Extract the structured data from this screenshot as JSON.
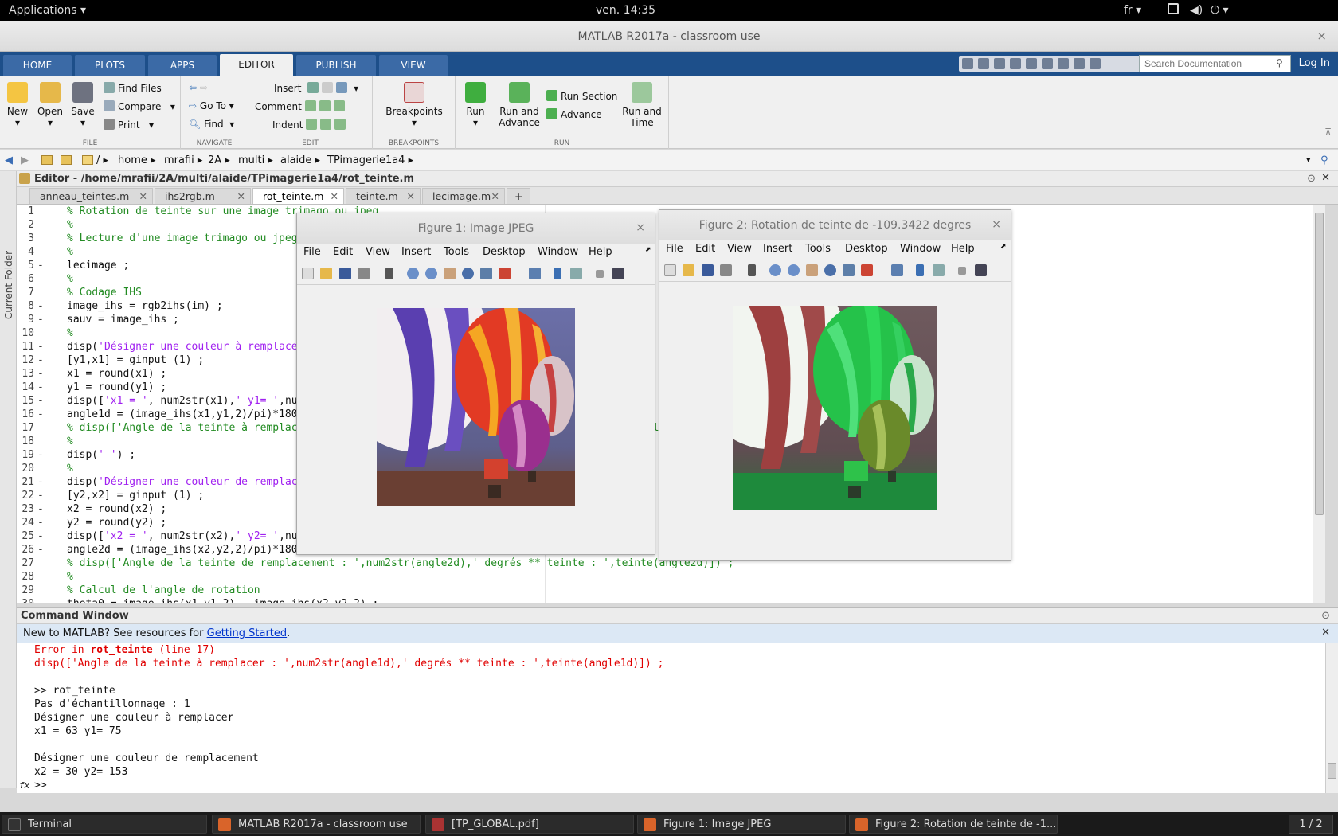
{
  "topbar": {
    "applications": "Applications",
    "clock": "ven. 14:35",
    "lang": "fr"
  },
  "window": {
    "title": "MATLAB R2017a - classroom use",
    "close": "×"
  },
  "tabs": [
    "HOME",
    "PLOTS",
    "APPS",
    "EDITOR",
    "PUBLISH",
    "VIEW"
  ],
  "active_tab": "EDITOR",
  "search": {
    "placeholder": "Search Documentation"
  },
  "login": "Log In",
  "ribbon": {
    "file": {
      "label": "FILE",
      "new": "New",
      "open": "Open",
      "save": "Save",
      "find_files": "Find Files",
      "compare": "Compare",
      "print": "Print"
    },
    "navigate": {
      "label": "NAVIGATE",
      "go_to": "Go To",
      "find": "Find"
    },
    "edit": {
      "label": "EDIT",
      "insert": "Insert",
      "comment": "Comment",
      "indent": "Indent"
    },
    "breakpoints": {
      "label": "BREAKPOINTS",
      "breakpoints": "Breakpoints"
    },
    "run": {
      "label": "RUN",
      "run": "Run",
      "run_and_advance": "Run and Advance",
      "run_section": "Run Section",
      "advance": "Advance",
      "run_and_time": "Run and Time"
    }
  },
  "path": [
    "/",
    "home",
    "mrafii",
    "2A",
    "multi",
    "alaide",
    "TPimagerie1a4"
  ],
  "side": {
    "current_folder": "Current Folder"
  },
  "editor": {
    "title": "Editor - /home/mrafii/2A/multi/alaide/TPimagerie1a4/rot_teinte.m",
    "tabs": [
      "anneau_teintes.m",
      "ihs2rgb.m",
      "rot_teinte.m",
      "teinte.m",
      "lecimage.m"
    ],
    "active_tab": "rot_teinte.m",
    "add_tab": "+",
    "lines": [
      {
        "n": "1",
        "dash": "",
        "segs": [
          {
            "t": "% Rotation de teinte sur une image trimago ou jpeg",
            "c": "cm"
          }
        ]
      },
      {
        "n": "2",
        "dash": "",
        "segs": [
          {
            "t": "%",
            "c": "cm"
          }
        ]
      },
      {
        "n": "3",
        "dash": "",
        "segs": [
          {
            "t": "% Lecture d'une image trimago ou jpeg",
            "c": "cm"
          }
        ]
      },
      {
        "n": "4",
        "dash": "",
        "segs": [
          {
            "t": "%",
            "c": "cm"
          }
        ]
      },
      {
        "n": "5",
        "dash": "-",
        "segs": [
          {
            "t": "lecimage ;",
            "c": ""
          }
        ]
      },
      {
        "n": "6",
        "dash": "",
        "segs": [
          {
            "t": "%",
            "c": "cm"
          }
        ]
      },
      {
        "n": "7",
        "dash": "",
        "segs": [
          {
            "t": "% Codage IHS",
            "c": "cm"
          }
        ]
      },
      {
        "n": "8",
        "dash": "-",
        "segs": [
          {
            "t": "image_ihs = rgb2ihs(im) ;",
            "c": ""
          }
        ]
      },
      {
        "n": "9",
        "dash": "-",
        "segs": [
          {
            "t": "sauv = image_ihs ;",
            "c": ""
          }
        ]
      },
      {
        "n": "10",
        "dash": "",
        "segs": [
          {
            "t": "%",
            "c": "cm"
          }
        ]
      },
      {
        "n": "11",
        "dash": "-",
        "segs": [
          {
            "t": "disp(",
            "c": ""
          },
          {
            "t": "'Désigner une couleur à remplacer'",
            "c": "st"
          },
          {
            "t": ") ;",
            "c": ""
          }
        ]
      },
      {
        "n": "12",
        "dash": "-",
        "segs": [
          {
            "t": "[y1,x1] = ginput (1) ;",
            "c": ""
          }
        ]
      },
      {
        "n": "13",
        "dash": "-",
        "segs": [
          {
            "t": "x1 = round(x1) ;",
            "c": ""
          }
        ]
      },
      {
        "n": "14",
        "dash": "-",
        "segs": [
          {
            "t": "y1 = round(y1) ;",
            "c": ""
          }
        ]
      },
      {
        "n": "15",
        "dash": "-",
        "segs": [
          {
            "t": "disp([",
            "c": ""
          },
          {
            "t": "'x1 = '",
            "c": "st"
          },
          {
            "t": ", num2str(x1),",
            "c": ""
          },
          {
            "t": "' y1= '",
            "c": "st"
          },
          {
            "t": ",num2str(y1)]) ;",
            "c": ""
          }
        ]
      },
      {
        "n": "16",
        "dash": "-",
        "segs": [
          {
            "t": "angle1d = (image_ihs(x1,y1,2)/pi)*180 ;",
            "c": ""
          }
        ]
      },
      {
        "n": "17",
        "dash": "",
        "segs": [
          {
            "t": "% disp(['Angle de la teinte à remplacer : ',num2str(angle1d),' degrés ** teinte : ',teinte(angle1d)]) ;",
            "c": "cm"
          }
        ]
      },
      {
        "n": "18",
        "dash": "",
        "segs": [
          {
            "t": "%",
            "c": "cm"
          }
        ]
      },
      {
        "n": "19",
        "dash": "-",
        "segs": [
          {
            "t": "disp(",
            "c": ""
          },
          {
            "t": "' '",
            "c": "st"
          },
          {
            "t": ") ;",
            "c": ""
          }
        ]
      },
      {
        "n": "20",
        "dash": "",
        "segs": [
          {
            "t": "%",
            "c": "cm"
          }
        ]
      },
      {
        "n": "21",
        "dash": "-",
        "segs": [
          {
            "t": "disp(",
            "c": ""
          },
          {
            "t": "'Désigner une couleur de remplacement'",
            "c": "st"
          },
          {
            "t": ") ;",
            "c": ""
          }
        ]
      },
      {
        "n": "22",
        "dash": "-",
        "segs": [
          {
            "t": "[y2,x2] = ginput (1) ;",
            "c": ""
          }
        ]
      },
      {
        "n": "23",
        "dash": "-",
        "segs": [
          {
            "t": "x2 = round(x2) ;",
            "c": ""
          }
        ]
      },
      {
        "n": "24",
        "dash": "-",
        "segs": [
          {
            "t": "y2 = round(y2) ;",
            "c": ""
          }
        ]
      },
      {
        "n": "25",
        "dash": "-",
        "segs": [
          {
            "t": "disp([",
            "c": ""
          },
          {
            "t": "'x2 = '",
            "c": "st"
          },
          {
            "t": ", num2str(x2),",
            "c": ""
          },
          {
            "t": "' y2= '",
            "c": "st"
          },
          {
            "t": ",num2str(y2)]) ;",
            "c": ""
          }
        ]
      },
      {
        "n": "26",
        "dash": "-",
        "segs": [
          {
            "t": "angle2d = (image_ihs(x2,y2,2)/pi)*180 ;",
            "c": ""
          }
        ]
      },
      {
        "n": "27",
        "dash": "",
        "segs": [
          {
            "t": "% disp(['Angle de la teinte de remplacement : ',num2str(angle2d),' degrés ** teinte : ',teinte(angle2d)]) ;",
            "c": "cm"
          }
        ]
      },
      {
        "n": "28",
        "dash": "",
        "segs": [
          {
            "t": "%",
            "c": "cm"
          }
        ]
      },
      {
        "n": "29",
        "dash": "",
        "segs": [
          {
            "t": "% Calcul de l'angle de rotation",
            "c": "cm"
          }
        ]
      },
      {
        "n": "30",
        "dash": "-",
        "segs": [
          {
            "t": "theta0 = image_ihs(x1,y1,2) - image_ihs(x2,y2,2) ;",
            "c": ""
          }
        ]
      }
    ]
  },
  "figure1": {
    "title": "Figure 1: Image JPEG",
    "close": "×"
  },
  "figure2": {
    "title": "Figure 2: Rotation de teinte de -109.3422 degres",
    "close": "×"
  },
  "figmenu": [
    "File",
    "Edit",
    "View",
    "Insert",
    "Tools",
    "Desktop",
    "Window",
    "Help"
  ],
  "command_window": {
    "title": "Command Window",
    "banner_text": "New to MATLAB? See resources for ",
    "banner_link": "Getting Started",
    "banner_end": ".",
    "error_in": "Error in ",
    "error_fn": "rot_teinte",
    "error_open": " (",
    "error_line": "line 17",
    "error_close": ")",
    "error_code": "disp(['Angle de la teinte à remplacer : ',num2str(angle1d),' degrés ** teinte : ',teinte(angle1d)]) ;",
    "lines": [
      ">> rot_teinte",
      "Pas d'échantillonnage : 1",
      "Désigner une couleur à remplacer",
      "x1 = 63 y1= 75",
      "",
      "Désigner une couleur de remplacement",
      "x2 = 30 y2= 153"
    ],
    "fx": "fx",
    "prompt": ">>"
  },
  "taskbar": {
    "items": [
      "Terminal",
      "MATLAB R2017a - classroom use",
      "[TP_GLOBAL.pdf]",
      "Figure 1: Image JPEG",
      "Figure 2: Rotation de teinte de -1..."
    ],
    "pager": "1 / 2"
  },
  "colors": {
    "tab_bar": "#1d4f8a",
    "comment": "#228b22",
    "string": "#a020f0",
    "error": "#e00000",
    "link": "#0033cc"
  },
  "icons": [
    "new-icon",
    "open-icon",
    "save-icon",
    "run-icon",
    "breakpoints-icon",
    "search-icon",
    "close-icon",
    "matlab-icon",
    "pdf-icon"
  ]
}
